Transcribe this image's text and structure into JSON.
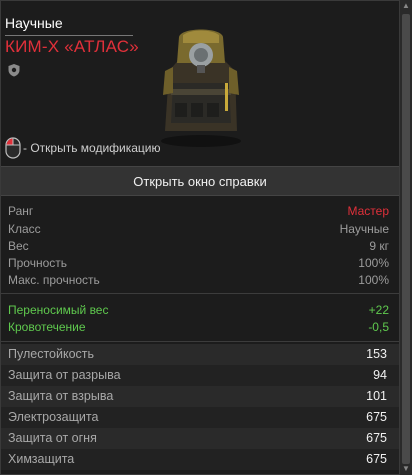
{
  "item": {
    "category": "Научные",
    "name": "КИМ-Х «АТЛАС»",
    "hint": "- Открыть модификацию"
  },
  "help_button": "Открыть окно справки",
  "info": [
    {
      "label": "Ранг",
      "value": "Мастер"
    },
    {
      "label": "Класс",
      "value": "Научные"
    },
    {
      "label": "Вес",
      "value": "9 кг"
    },
    {
      "label": "Прочность",
      "value": "100%"
    },
    {
      "label": "Макс. прочность",
      "value": "100%"
    }
  ],
  "bonuses": [
    {
      "label": "Переносимый вес",
      "value": "+22"
    },
    {
      "label": "Кровотечение",
      "value": "-0,5"
    }
  ],
  "stats": [
    {
      "label": "Пулестойкость",
      "value": "153"
    },
    {
      "label": "Защита от разрыва",
      "value": "94"
    },
    {
      "label": "Защита от взрыва",
      "value": "101"
    },
    {
      "label": "Электрозащита",
      "value": "675"
    },
    {
      "label": "Защита от огня",
      "value": "675"
    },
    {
      "label": "Химзащита",
      "value": "675"
    }
  ],
  "colors": {
    "rank": "#e0303a",
    "bonus": "#5fc94e"
  },
  "icons": [
    "shield-icon",
    "mouse-icon",
    "armor-image"
  ]
}
